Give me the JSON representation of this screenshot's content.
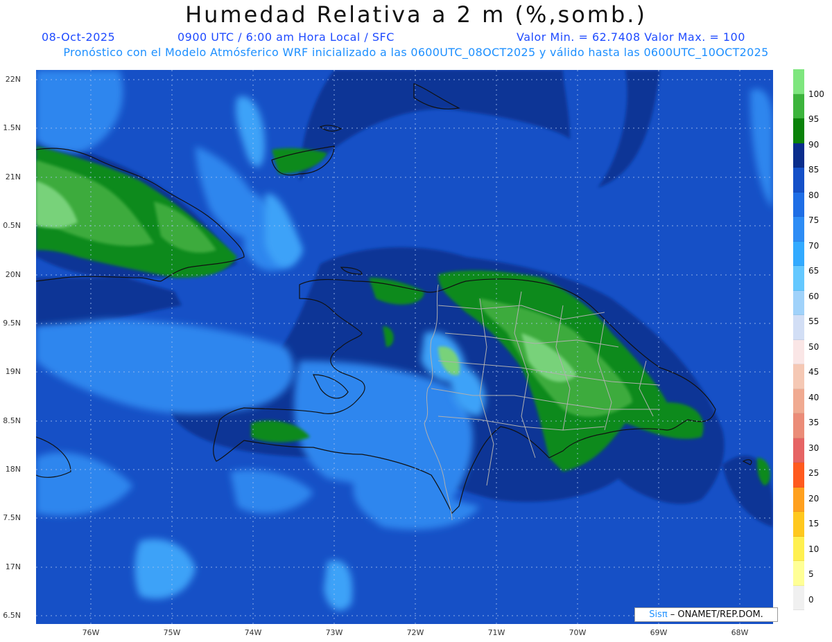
{
  "title": "Humedad Relativa a 2 m (%,somb.)",
  "header": {
    "date": "08-Oct-2025",
    "time": "0900 UTC / 6:00 am Hora Local / SFC",
    "minmax": "Valor Min. = 62.7408  Valor Max. = 100",
    "forecast": "Pronóstico con el Modelo Atmósferico WRF inicializado a las 0600UTC_08OCT2025 y válido hasta las  0600UTC_10OCT2025"
  },
  "lat_labels": [
    "22N",
    "1.5N",
    "21N",
    "0.5N",
    "20N",
    "9.5N",
    "19N",
    "8.5N",
    "18N",
    "7.5N",
    "17N",
    "6.5N"
  ],
  "lon_labels": [
    "76W",
    "75W",
    "74W",
    "73W",
    "72W",
    "71W",
    "70W",
    "69W",
    "68W"
  ],
  "colorbar": {
    "labels": [
      "100",
      "95",
      "90",
      "85",
      "80",
      "75",
      "70",
      "65",
      "60",
      "55",
      "50",
      "45",
      "40",
      "35",
      "30",
      "25",
      "20",
      "15",
      "10",
      "5",
      "0"
    ],
    "colors": [
      "#7ee67e",
      "#3cb43c",
      "#0a820a",
      "#0a2d8c",
      "#1450c8",
      "#1e6ee6",
      "#2d8cf5",
      "#32aaff",
      "#64c8ff",
      "#a0d2fa",
      "#d2def5",
      "#fae6e6",
      "#f5c8b4",
      "#f0aa91",
      "#eb8c78",
      "#e66464",
      "#ff5a1e",
      "#ffa01e",
      "#ffc81e",
      "#fff050",
      "#ffff96",
      "#f0f0f0"
    ]
  },
  "map_colors": {
    "sea": "#1650c6",
    "dark": "#0a3496",
    "light": "#2f86ee",
    "lighter": "#3da2f8",
    "green": "#0b8a1e",
    "greenlight": "#3dab3d",
    "greenpale": "#78d27a",
    "coast": "#111111",
    "border": "#b0b0b0"
  },
  "credit": {
    "logo": "Sisπ",
    "text": " – ONAMET/REP.DOM."
  }
}
